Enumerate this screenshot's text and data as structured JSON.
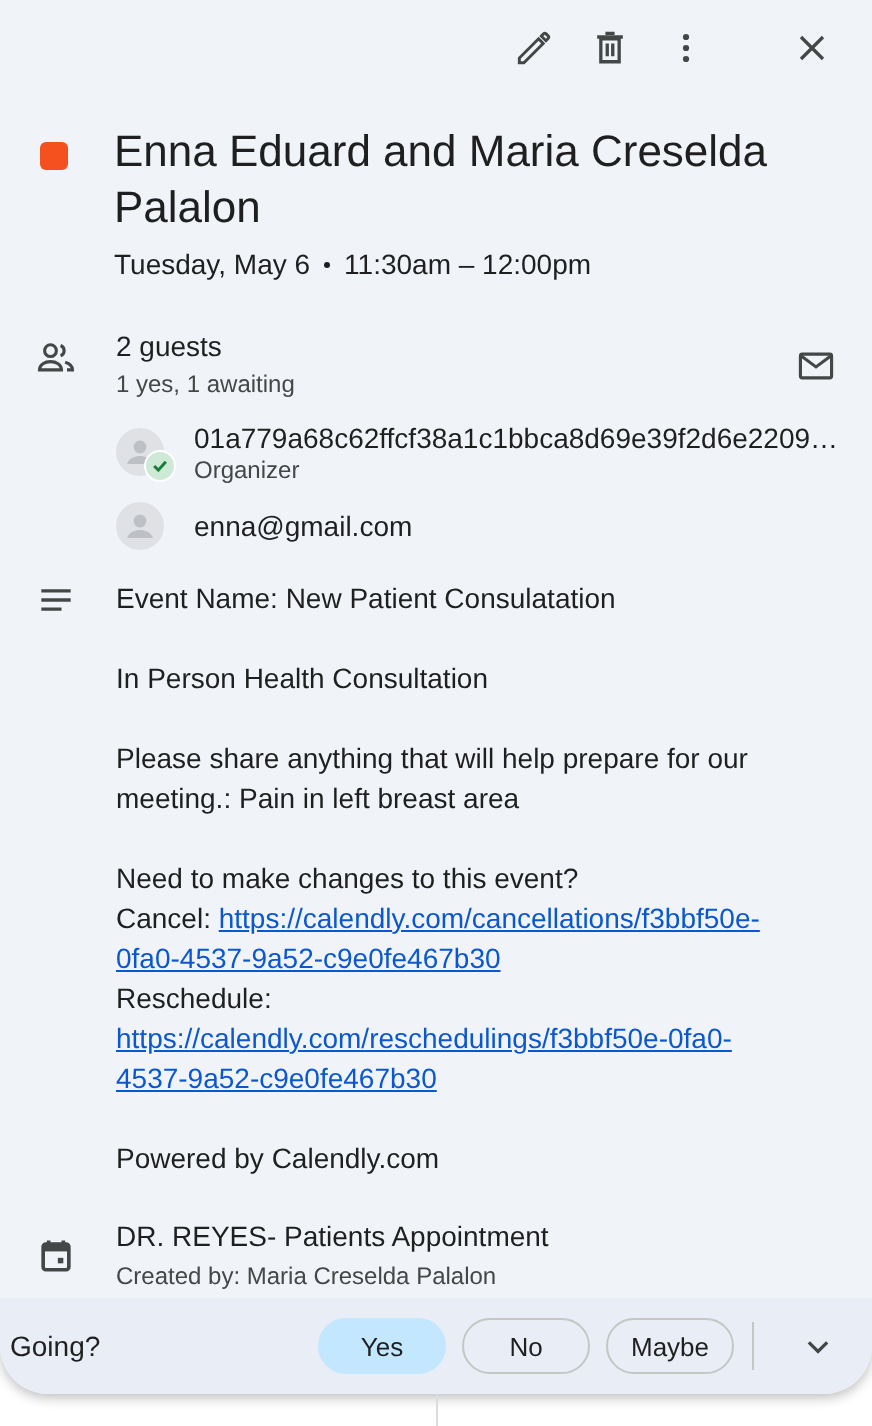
{
  "event": {
    "color": "#f4511e",
    "title": "Enna Eduard and Maria Creselda Palalon",
    "date": "Tuesday, May 6",
    "time": "11:30am – 12:00pm"
  },
  "guests": {
    "count": "2 guests",
    "summary": "1 yes, 1 awaiting",
    "list": [
      {
        "name": "01a779a68c62ffcf38a1c1bbca8d69e39f2d6e2209…",
        "role": "Organizer",
        "accepted": true
      },
      {
        "name": "enna@gmail.com",
        "accepted": false
      }
    ]
  },
  "description": [
    [
      [
        {
          "kind": "text",
          "text": "Event Name: New Patient Consulatation"
        }
      ]
    ],
    [
      [
        {
          "kind": "text",
          "text": "In Person Health Consultation"
        }
      ]
    ],
    [
      [
        {
          "kind": "text",
          "text": "Please share anything that will help prepare for our meeting.: Pain in left breast area"
        }
      ]
    ],
    [
      [
        {
          "kind": "text",
          "text": "Need to make changes to this event?"
        }
      ],
      [
        {
          "kind": "text",
          "text": "Cancel:"
        },
        {
          "kind": "link",
          "text": "https://calendly.com/cancellations/f3bbf50e-"
        }
      ],
      [
        {
          "kind": "link",
          "text": "0fa0-4537-9a52-c9e0fe467b30"
        }
      ],
      [
        {
          "kind": "text",
          "text": "Reschedule:"
        }
      ],
      [
        {
          "kind": "link",
          "text": "https://calendly.com/reschedulings/f3bbf50e-0fa0-"
        }
      ],
      [
        {
          "kind": "link",
          "text": "4537-9a52-c9e0fe467b30"
        }
      ]
    ],
    [
      [
        {
          "kind": "text",
          "text": "Powered by Calendly.com"
        }
      ]
    ]
  ],
  "calendar": {
    "name": "DR. REYES- Patients Appointment",
    "creator": "Created by: Maria Creselda Palalon"
  },
  "rsvp": {
    "label": "Going?",
    "options": [
      {
        "label": "Yes",
        "selected": true
      },
      {
        "label": "No",
        "selected": false
      },
      {
        "label": "Maybe",
        "selected": false
      }
    ]
  }
}
